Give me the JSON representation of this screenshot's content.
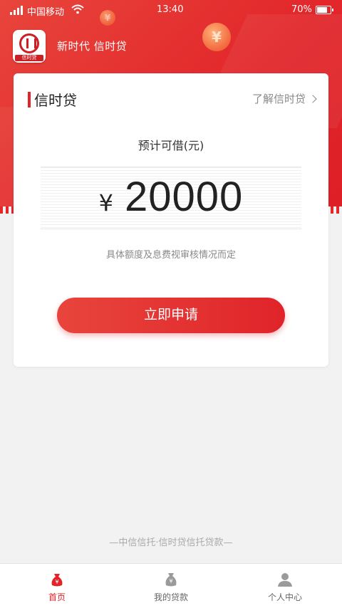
{
  "status_bar": {
    "carrier": "中国移动",
    "time": "13:40",
    "battery": "70%"
  },
  "app": {
    "logo_tag": "信时贷",
    "title": "新时代 信时贷"
  },
  "card": {
    "title": "信时贷",
    "learn_more": "了解信时贷",
    "estimate_label": "预计可借(元)",
    "currency": "¥",
    "amount": "20000",
    "note": "具体额度及息费视审核情况而定",
    "apply_button": "立即申请"
  },
  "footer": {
    "text": "—中信信托·信时贷信托贷款—"
  },
  "tabs": [
    {
      "label": "首页",
      "icon": "home-moneybag-icon",
      "active": true
    },
    {
      "label": "我的贷款",
      "icon": "loan-bag-icon",
      "active": false
    },
    {
      "label": "个人中心",
      "icon": "user-icon",
      "active": false
    }
  ],
  "colors": {
    "brand_red": "#e0242a",
    "background": "#f2f2f2"
  }
}
